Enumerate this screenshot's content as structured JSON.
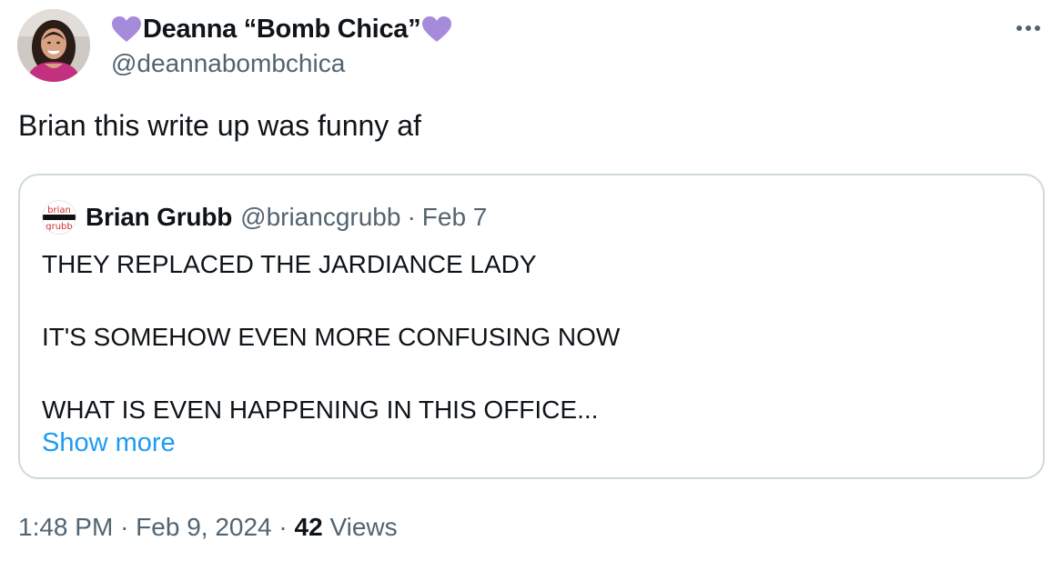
{
  "tweet": {
    "author": {
      "display_name": "Deanna “Bomb Chica”",
      "handle": "@deannabombchica",
      "avatar_icon": "profile-photo"
    },
    "heart_emoji": "purple-heart",
    "more_icon": "more-horizontal-icon",
    "text": "Brian this write up was funny af",
    "quote": {
      "author_name": "Brian Grubb",
      "author_handle": "@briancgrubb",
      "separator": "·",
      "date": "Feb 7",
      "avatar_text_top": "brian",
      "avatar_text_bottom": "grubb",
      "lines": [
        "THEY REPLACED THE JARDIANCE LADY",
        "IT'S SOMEHOW EVEN MORE CONFUSING NOW",
        "WHAT IS EVEN HAPPENING IN THIS OFFICE..."
      ],
      "show_more": "Show more"
    },
    "meta": {
      "time": "1:48 PM",
      "sep1": "·",
      "date": "Feb 9, 2024",
      "sep2": "·",
      "views_count": "42",
      "views_label": "Views"
    }
  },
  "colors": {
    "text_primary": "#0f1419",
    "text_secondary": "#536471",
    "link": "#1d9bf0",
    "border": "#cfd9de",
    "heart": "#a78bdb"
  }
}
